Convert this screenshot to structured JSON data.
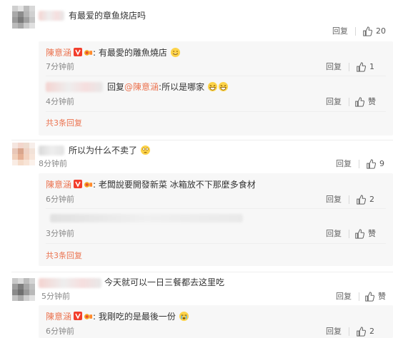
{
  "comments": [
    {
      "text": "有最爱的章鱼烧店吗",
      "actions": {
        "reply": "回复",
        "likes": "20"
      },
      "replies": [
        {
          "name": "陳意涵",
          "text": "有最愛的雕魚燒店",
          "time": "7分钟前",
          "reply": "回复",
          "likes": "1",
          "emoji": "grin-emoji"
        },
        {
          "prefix": "回复",
          "mention": "@陳意涵",
          "text": ":所以是哪家",
          "time": "4分钟前",
          "reply": "回复",
          "likes": "赞",
          "emoji": "laugh-emoji"
        }
      ],
      "more": "共3条回复"
    },
    {
      "text": "所以为什么不卖了",
      "time": "8分钟前",
      "actions": {
        "reply": "回复",
        "likes": "9"
      },
      "replies": [
        {
          "name": "陳意涵",
          "text": "老闆說要開發新菜 冰箱放不下那麼多食材",
          "time": "6分钟前",
          "reply": "回复",
          "likes": "2"
        },
        {
          "time": "3分钟前",
          "reply": "回复",
          "likes": "赞"
        }
      ],
      "more": "共3条回复"
    },
    {
      "text": "今天就可以一日三餐都去这里吃",
      "time": "5分钟前",
      "actions": {
        "reply": "回复",
        "likes": "赞"
      },
      "replies": [
        {
          "name": "陳意涵",
          "text": "我剛吃的是最後一份",
          "time": "6分钟前",
          "reply": "回复",
          "likes": "2",
          "emoji": "crying-emoji"
        }
      ]
    }
  ],
  "colors": {
    "accent": "#eb7350",
    "reply_bg": "#f7f7f7",
    "vip_red": "#f23e2c"
  }
}
